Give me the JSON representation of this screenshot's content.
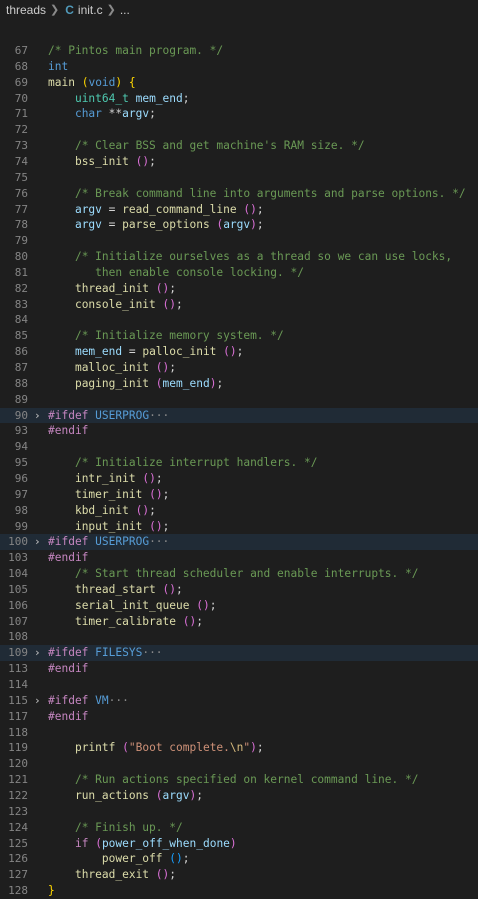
{
  "breadcrumb": {
    "folder": "threads",
    "file_icon": "C",
    "file": "init.c",
    "more": "..."
  },
  "colors": {
    "comment": "#6a9955",
    "keyword": "#569cd6",
    "function": "#dcdcaa",
    "variable": "#9cdcfe",
    "string": "#ce9178"
  },
  "lines": [
    {
      "n": "67",
      "t": [
        [
          "cmt",
          "/* Pintos main program. */"
        ]
      ]
    },
    {
      "n": "68",
      "t": [
        [
          "kw",
          "int"
        ]
      ]
    },
    {
      "n": "69",
      "t": [
        [
          "fn",
          "main"
        ],
        [
          "plain",
          " "
        ],
        [
          "br1",
          "("
        ],
        [
          "kw",
          "void"
        ],
        [
          "br1",
          ")"
        ],
        [
          "plain",
          " "
        ],
        [
          "br1",
          "{"
        ]
      ]
    },
    {
      "n": "70",
      "t": [
        [
          "plain",
          "    "
        ],
        [
          "type",
          "uint64_t"
        ],
        [
          "plain",
          " "
        ],
        [
          "var",
          "mem_end"
        ],
        [
          "plain",
          ";"
        ]
      ]
    },
    {
      "n": "71",
      "t": [
        [
          "plain",
          "    "
        ],
        [
          "kw",
          "char"
        ],
        [
          "plain",
          " **"
        ],
        [
          "var",
          "argv"
        ],
        [
          "plain",
          ";"
        ]
      ]
    },
    {
      "n": "72",
      "t": []
    },
    {
      "n": "73",
      "t": [
        [
          "plain",
          "    "
        ],
        [
          "cmt",
          "/* Clear BSS and get machine's RAM size. */"
        ]
      ]
    },
    {
      "n": "74",
      "t": [
        [
          "plain",
          "    "
        ],
        [
          "fn",
          "bss_init"
        ],
        [
          "plain",
          " "
        ],
        [
          "br2",
          "("
        ],
        [
          "br2",
          ")"
        ],
        [
          "plain",
          ";"
        ]
      ]
    },
    {
      "n": "75",
      "t": []
    },
    {
      "n": "76",
      "t": [
        [
          "plain",
          "    "
        ],
        [
          "cmt",
          "/* Break command line into arguments and parse options. */"
        ]
      ]
    },
    {
      "n": "77",
      "t": [
        [
          "plain",
          "    "
        ],
        [
          "var",
          "argv"
        ],
        [
          "plain",
          " = "
        ],
        [
          "fn",
          "read_command_line"
        ],
        [
          "plain",
          " "
        ],
        [
          "br2",
          "("
        ],
        [
          "br2",
          ")"
        ],
        [
          "plain",
          ";"
        ]
      ]
    },
    {
      "n": "78",
      "t": [
        [
          "plain",
          "    "
        ],
        [
          "var",
          "argv"
        ],
        [
          "plain",
          " = "
        ],
        [
          "fn",
          "parse_options"
        ],
        [
          "plain",
          " "
        ],
        [
          "br2",
          "("
        ],
        [
          "var",
          "argv"
        ],
        [
          "br2",
          ")"
        ],
        [
          "plain",
          ";"
        ]
      ]
    },
    {
      "n": "79",
      "t": []
    },
    {
      "n": "80",
      "t": [
        [
          "plain",
          "    "
        ],
        [
          "cmt",
          "/* Initialize ourselves as a thread so we can use locks,"
        ]
      ]
    },
    {
      "n": "81",
      "t": [
        [
          "plain",
          "    "
        ],
        [
          "cmt",
          "   then enable console locking. */"
        ]
      ]
    },
    {
      "n": "82",
      "t": [
        [
          "plain",
          "    "
        ],
        [
          "fn",
          "thread_init"
        ],
        [
          "plain",
          " "
        ],
        [
          "br2",
          "("
        ],
        [
          "br2",
          ")"
        ],
        [
          "plain",
          ";"
        ]
      ]
    },
    {
      "n": "83",
      "t": [
        [
          "plain",
          "    "
        ],
        [
          "fn",
          "console_init"
        ],
        [
          "plain",
          " "
        ],
        [
          "br2",
          "("
        ],
        [
          "br2",
          ")"
        ],
        [
          "plain",
          ";"
        ]
      ]
    },
    {
      "n": "84",
      "t": []
    },
    {
      "n": "85",
      "t": [
        [
          "plain",
          "    "
        ],
        [
          "cmt",
          "/* Initialize memory system. */"
        ]
      ]
    },
    {
      "n": "86",
      "t": [
        [
          "plain",
          "    "
        ],
        [
          "var",
          "mem_end"
        ],
        [
          "plain",
          " = "
        ],
        [
          "fn",
          "palloc_init"
        ],
        [
          "plain",
          " "
        ],
        [
          "br2",
          "("
        ],
        [
          "br2",
          ")"
        ],
        [
          "plain",
          ";"
        ]
      ]
    },
    {
      "n": "87",
      "t": [
        [
          "plain",
          "    "
        ],
        [
          "fn",
          "malloc_init"
        ],
        [
          "plain",
          " "
        ],
        [
          "br2",
          "("
        ],
        [
          "br2",
          ")"
        ],
        [
          "plain",
          ";"
        ]
      ]
    },
    {
      "n": "88",
      "t": [
        [
          "plain",
          "    "
        ],
        [
          "fn",
          "paging_init"
        ],
        [
          "plain",
          " "
        ],
        [
          "br2",
          "("
        ],
        [
          "var",
          "mem_end"
        ],
        [
          "br2",
          ")"
        ],
        [
          "plain",
          ";"
        ]
      ]
    },
    {
      "n": "89",
      "t": []
    },
    {
      "n": "90",
      "fold": "›",
      "folded": true,
      "t": [
        [
          "pp",
          "#ifdef"
        ],
        [
          "plain",
          " "
        ],
        [
          "macro",
          "USERPROG"
        ],
        [
          "ell",
          "···"
        ]
      ]
    },
    {
      "n": "93",
      "t": [
        [
          "pp",
          "#endif"
        ]
      ]
    },
    {
      "n": "94",
      "t": []
    },
    {
      "n": "95",
      "t": [
        [
          "plain",
          "    "
        ],
        [
          "cmt",
          "/* Initialize interrupt handlers. */"
        ]
      ]
    },
    {
      "n": "96",
      "t": [
        [
          "plain",
          "    "
        ],
        [
          "fn",
          "intr_init"
        ],
        [
          "plain",
          " "
        ],
        [
          "br2",
          "("
        ],
        [
          "br2",
          ")"
        ],
        [
          "plain",
          ";"
        ]
      ]
    },
    {
      "n": "97",
      "t": [
        [
          "plain",
          "    "
        ],
        [
          "fn",
          "timer_init"
        ],
        [
          "plain",
          " "
        ],
        [
          "br2",
          "("
        ],
        [
          "br2",
          ")"
        ],
        [
          "plain",
          ";"
        ]
      ]
    },
    {
      "n": "98",
      "t": [
        [
          "plain",
          "    "
        ],
        [
          "fn",
          "kbd_init"
        ],
        [
          "plain",
          " "
        ],
        [
          "br2",
          "("
        ],
        [
          "br2",
          ")"
        ],
        [
          "plain",
          ";"
        ]
      ]
    },
    {
      "n": "99",
      "t": [
        [
          "plain",
          "    "
        ],
        [
          "fn",
          "input_init"
        ],
        [
          "plain",
          " "
        ],
        [
          "br2",
          "("
        ],
        [
          "br2",
          ")"
        ],
        [
          "plain",
          ";"
        ]
      ]
    },
    {
      "n": "100",
      "fold": "›",
      "folded": true,
      "t": [
        [
          "pp",
          "#ifdef"
        ],
        [
          "plain",
          " "
        ],
        [
          "macro",
          "USERPROG"
        ],
        [
          "ell",
          "···"
        ]
      ]
    },
    {
      "n": "103",
      "t": [
        [
          "pp",
          "#endif"
        ]
      ]
    },
    {
      "n": "104",
      "t": [
        [
          "plain",
          "    "
        ],
        [
          "cmt",
          "/* Start thread scheduler and enable interrupts. */"
        ]
      ]
    },
    {
      "n": "105",
      "t": [
        [
          "plain",
          "    "
        ],
        [
          "fn",
          "thread_start"
        ],
        [
          "plain",
          " "
        ],
        [
          "br2",
          "("
        ],
        [
          "br2",
          ")"
        ],
        [
          "plain",
          ";"
        ]
      ]
    },
    {
      "n": "106",
      "t": [
        [
          "plain",
          "    "
        ],
        [
          "fn",
          "serial_init_queue"
        ],
        [
          "plain",
          " "
        ],
        [
          "br2",
          "("
        ],
        [
          "br2",
          ")"
        ],
        [
          "plain",
          ";"
        ]
      ]
    },
    {
      "n": "107",
      "t": [
        [
          "plain",
          "    "
        ],
        [
          "fn",
          "timer_calibrate"
        ],
        [
          "plain",
          " "
        ],
        [
          "br2",
          "("
        ],
        [
          "br2",
          ")"
        ],
        [
          "plain",
          ";"
        ]
      ]
    },
    {
      "n": "108",
      "t": []
    },
    {
      "n": "109",
      "fold": "›",
      "folded": true,
      "t": [
        [
          "pp",
          "#ifdef"
        ],
        [
          "plain",
          " "
        ],
        [
          "macro",
          "FILESYS"
        ],
        [
          "ell",
          "···"
        ]
      ]
    },
    {
      "n": "113",
      "t": [
        [
          "pp",
          "#endif"
        ]
      ]
    },
    {
      "n": "114",
      "t": []
    },
    {
      "n": "115",
      "fold": "›",
      "folded": false,
      "t": [
        [
          "pp",
          "#ifdef"
        ],
        [
          "plain",
          " "
        ],
        [
          "macro",
          "VM"
        ],
        [
          "ell",
          "···"
        ]
      ]
    },
    {
      "n": "117",
      "t": [
        [
          "pp",
          "#endif"
        ]
      ]
    },
    {
      "n": "118",
      "t": []
    },
    {
      "n": "119",
      "t": [
        [
          "plain",
          "    "
        ],
        [
          "fn",
          "printf"
        ],
        [
          "plain",
          " "
        ],
        [
          "br2",
          "("
        ],
        [
          "str",
          "\"Boot complete."
        ],
        [
          "esc",
          "\\n"
        ],
        [
          "str",
          "\""
        ],
        [
          "br2",
          ")"
        ],
        [
          "plain",
          ";"
        ]
      ]
    },
    {
      "n": "120",
      "t": []
    },
    {
      "n": "121",
      "t": [
        [
          "plain",
          "    "
        ],
        [
          "cmt",
          "/* Run actions specified on kernel command line. */"
        ]
      ]
    },
    {
      "n": "122",
      "t": [
        [
          "plain",
          "    "
        ],
        [
          "fn",
          "run_actions"
        ],
        [
          "plain",
          " "
        ],
        [
          "br2",
          "("
        ],
        [
          "var",
          "argv"
        ],
        [
          "br2",
          ")"
        ],
        [
          "plain",
          ";"
        ]
      ]
    },
    {
      "n": "123",
      "t": []
    },
    {
      "n": "124",
      "t": [
        [
          "plain",
          "    "
        ],
        [
          "cmt",
          "/* Finish up. */"
        ]
      ]
    },
    {
      "n": "125",
      "t": [
        [
          "plain",
          "    "
        ],
        [
          "ctrl",
          "if"
        ],
        [
          "plain",
          " "
        ],
        [
          "br2",
          "("
        ],
        [
          "var",
          "power_off_when_done"
        ],
        [
          "br2",
          ")"
        ]
      ]
    },
    {
      "n": "126",
      "t": [
        [
          "plain",
          "        "
        ],
        [
          "fn",
          "power_off"
        ],
        [
          "plain",
          " "
        ],
        [
          "br3",
          "("
        ],
        [
          "br3",
          ")"
        ],
        [
          "plain",
          ";"
        ]
      ]
    },
    {
      "n": "127",
      "t": [
        [
          "plain",
          "    "
        ],
        [
          "fn",
          "thread_exit"
        ],
        [
          "plain",
          " "
        ],
        [
          "br2",
          "("
        ],
        [
          "br2",
          ")"
        ],
        [
          "plain",
          ";"
        ]
      ]
    },
    {
      "n": "128",
      "t": [
        [
          "br1",
          "}"
        ]
      ]
    }
  ]
}
